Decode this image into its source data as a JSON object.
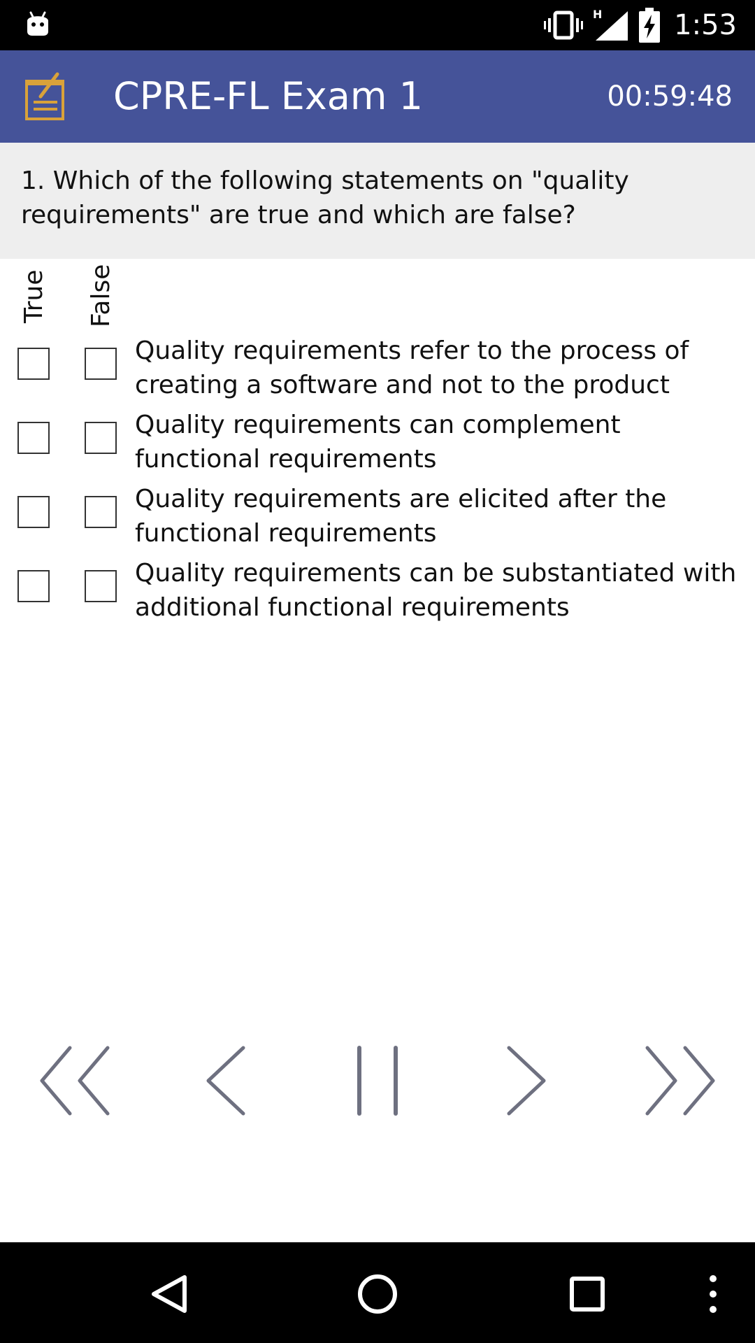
{
  "status_bar": {
    "time": "1:53",
    "network_label": "H",
    "icons": [
      "android-debug-icon",
      "vibrate-icon",
      "signal-icon",
      "battery-charging-icon"
    ]
  },
  "app_bar": {
    "title": "CPRE-FL Exam 1",
    "timer": "00:59:48",
    "logo_icon": "exam-notepad-icon"
  },
  "question": {
    "text": "1.  Which of the following statements on \"quality requirements\" are true and which are false?"
  },
  "columns": {
    "true_label": "True",
    "false_label": "False"
  },
  "answers": [
    {
      "text": "Quality requirements refer to the process of creating a software and not to the product",
      "true_checked": false,
      "false_checked": false
    },
    {
      "text": "Quality requirements can complement functional requirements",
      "true_checked": false,
      "false_checked": false
    },
    {
      "text": "Quality requirements are elicited after the functional requirements",
      "true_checked": false,
      "false_checked": false
    },
    {
      "text": "Quality requirements can be substantiated with additional functional requirements",
      "true_checked": false,
      "false_checked": false
    }
  ],
  "controls": [
    "first-question-icon",
    "previous-question-icon",
    "pause-icon",
    "next-question-icon",
    "last-question-icon"
  ],
  "system_nav": [
    "back-icon",
    "home-icon",
    "recents-icon",
    "overflow-menu-icon"
  ],
  "colors": {
    "app_bar": "#455399",
    "question_background": "#eeeeee",
    "controls": "#6e7080",
    "logo": "#d9a23a"
  }
}
